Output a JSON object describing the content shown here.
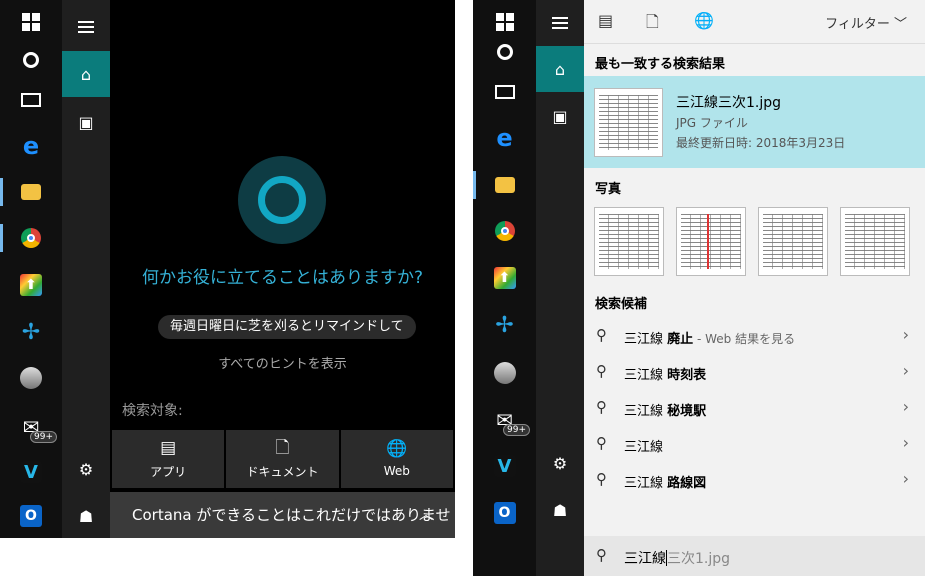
{
  "left": {
    "greeting": "何かお役に立てることはありますか?",
    "hint_button": "毎週日曜日に芝を刈るとリマインドして",
    "all_hints_link": "すべてのヒントを表示",
    "scope_label": "検索対象:",
    "scope_buttons": [
      {
        "label": "アプリ",
        "icon": "app-icon"
      },
      {
        "label": "ドキュメント",
        "icon": "document-icon"
      },
      {
        "label": "Web",
        "icon": "globe-icon"
      }
    ],
    "bottom_bar": "Cortana ができることはこれだけではありません...",
    "mail_badge": "99+"
  },
  "right": {
    "filter_label": "フィルター",
    "best_match_header": "最も一致する検索結果",
    "best_match": {
      "title": "三江線三次1.jpg",
      "type": "JPG ファイル",
      "modified": "最終更新日時: 2018年3月23日"
    },
    "photos_header": "写真",
    "suggestions_header": "検索候補",
    "suggestions": [
      {
        "prefix": "三江線 ",
        "bold": "廃止",
        "suffix": " - Web 結果を見る"
      },
      {
        "prefix": "三江線 ",
        "bold": "時刻表",
        "suffix": ""
      },
      {
        "prefix": "三江線 ",
        "bold": "秘境駅",
        "suffix": ""
      },
      {
        "prefix": "三江線",
        "bold": "",
        "suffix": ""
      },
      {
        "prefix": "三江線 ",
        "bold": "路線図",
        "suffix": ""
      }
    ],
    "search_typed": "三江線",
    "search_ghost": "三次1.jpg",
    "mail_badge": "99+"
  },
  "colors": {
    "accent_teal": "#0b7c7c",
    "cortana_blue": "#35b1d6",
    "best_match_bg": "#b1e4eb"
  }
}
